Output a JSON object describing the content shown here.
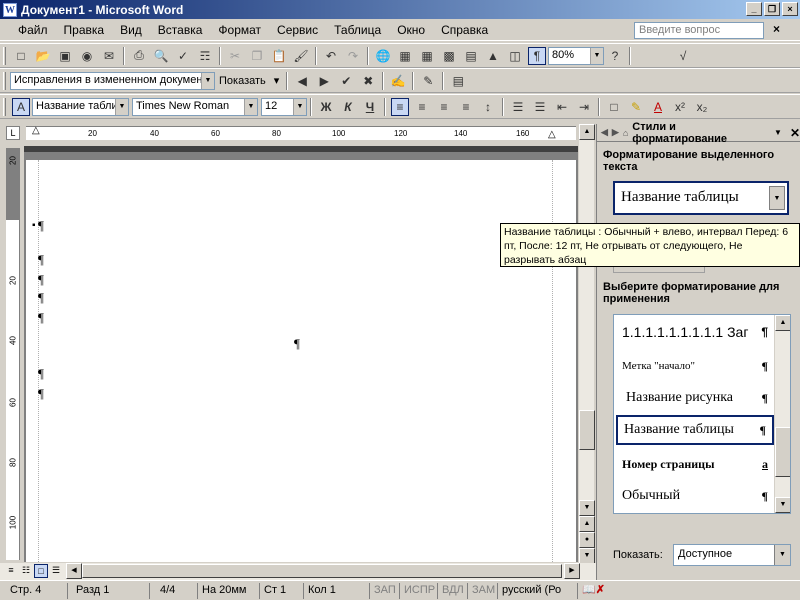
{
  "window": {
    "title": "Документ1 - Microsoft Word",
    "icon_letter": "W",
    "minimize": "_",
    "restore": "❐",
    "close": "×"
  },
  "menu": {
    "items": [
      "Файл",
      "Правка",
      "Вид",
      "Вставка",
      "Формат",
      "Сервис",
      "Таблица",
      "Окно",
      "Справка"
    ],
    "ask_placeholder": "Введите вопрос",
    "doc_close": "×"
  },
  "toolbar_standard": {
    "zoom": "80%"
  },
  "toolbar_review": {
    "view_mode": "Исправления в измененном документе",
    "show_label": "Показать"
  },
  "toolbar_format": {
    "style": "Название таблицы",
    "font": "Times New Roman",
    "size": "12",
    "bold": "Ж",
    "italic": "К",
    "underline": "Ч"
  },
  "ruler": {
    "corner": "L",
    "ticks": [
      "20",
      "40",
      "60",
      "80",
      "100",
      "120",
      "140",
      "160"
    ]
  },
  "vruler": {
    "ticks": [
      "20",
      "20",
      "40",
      "60",
      "80",
      "100"
    ]
  },
  "document": {
    "para_mark": "¶"
  },
  "taskpane": {
    "title": "Стили и форматирование",
    "selected_text_label": "Форматирование выделенного текста",
    "current_style": "Название таблицы",
    "apply_label": "Выберите форматирование для применения",
    "styles": [
      {
        "name": "1.1.1.1.1.1.1.1.1  Заг",
        "mark": "¶"
      },
      {
        "name": "Метка \"начало\"",
        "mark": "¶"
      },
      {
        "name": "Название рисунка",
        "mark": "¶"
      },
      {
        "name": "Название таблицы",
        "mark": "¶"
      },
      {
        "name": "Номер страницы",
        "mark": "a"
      },
      {
        "name": "Обычный",
        "mark": "¶"
      }
    ],
    "show_label": "Показать:",
    "show_value": "Доступное"
  },
  "tooltip": {
    "text": "Название таблицы : Обычный + влево, интервал Перед: 6 пт, После: 12 пт, Не отрывать от следующего, Не разрывать абзац"
  },
  "status": {
    "page": "Стр. 4",
    "section": "Разд 1",
    "pages": "4/4",
    "position": "На 20мм",
    "line": "Ст 1",
    "column": "Кол 1",
    "rec": "ЗАП",
    "trk": "ИСПР",
    "ext": "ВДЛ",
    "ovr": "ЗАМ",
    "language": "русский (Ро"
  }
}
